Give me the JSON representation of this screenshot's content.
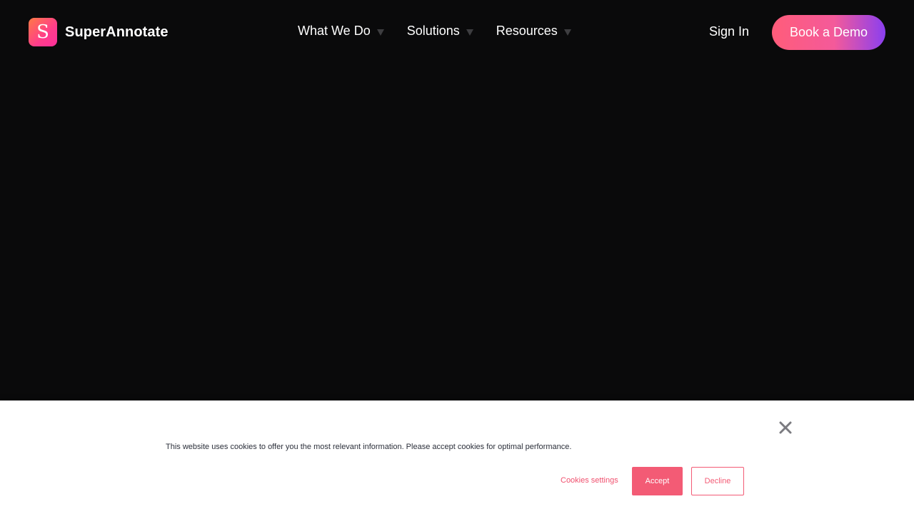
{
  "header": {
    "logo": {
      "letter": "S",
      "name": "SuperAnnotate"
    },
    "nav": [
      {
        "label": "What We Do"
      },
      {
        "label": "Solutions"
      },
      {
        "label": "Resources"
      }
    ],
    "sign_in": "Sign In",
    "cta": "Book a Demo"
  },
  "cookie_banner": {
    "message": "This website uses cookies to offer you the most relevant information. Please accept cookies for optimal performance.",
    "settings_label": "Cookies settings",
    "accept_label": "Accept",
    "decline_label": "Decline"
  },
  "icons": {
    "close": "close-icon",
    "dropdown": "caret-down-icon"
  },
  "colors": {
    "background": "#0a0a0b",
    "accent": "#f35b75",
    "cta_gradient_start": "#ff5c7a",
    "cta_gradient_end": "#8a3ff0"
  }
}
